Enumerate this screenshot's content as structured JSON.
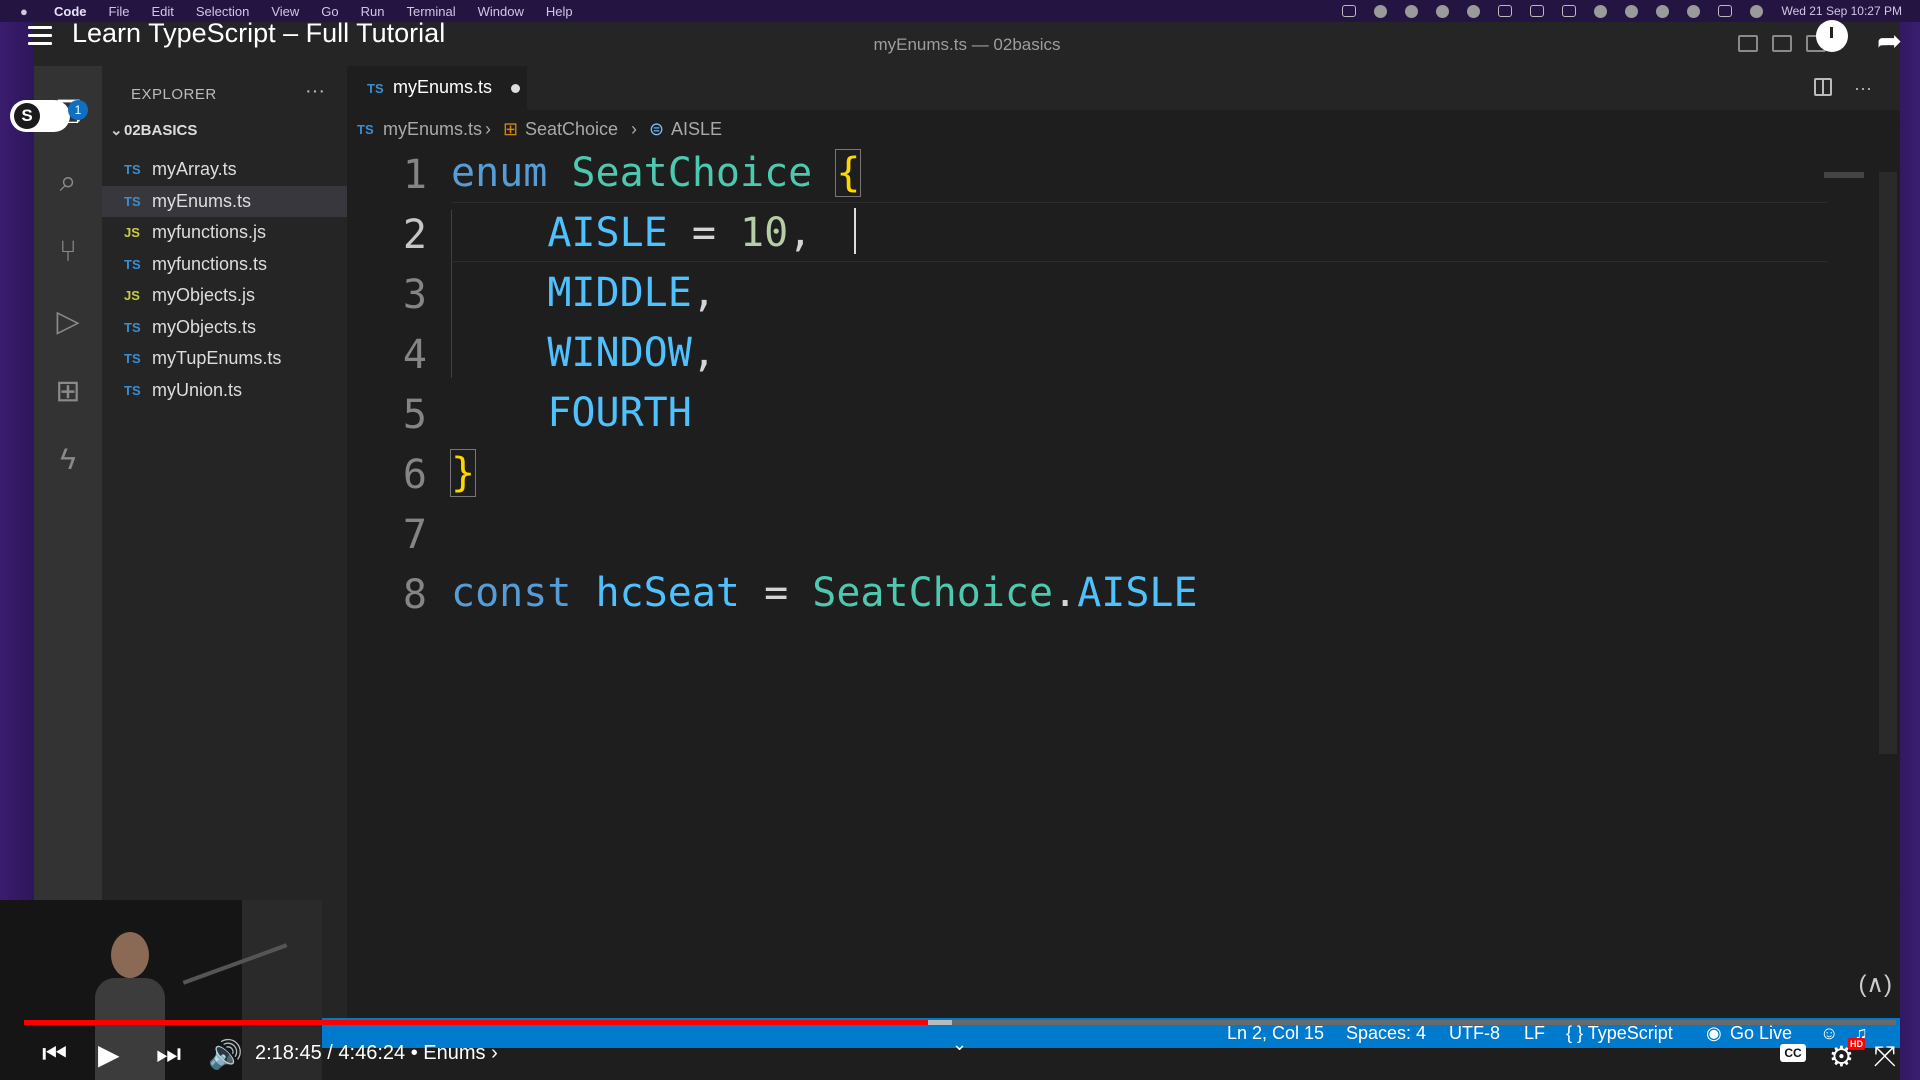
{
  "menubar": {
    "apple": "",
    "items": [
      "Code",
      "File",
      "Edit",
      "Selection",
      "View",
      "Go",
      "Run",
      "Terminal",
      "Window",
      "Help"
    ],
    "clock": "Wed 21 Sep  10:27 PM"
  },
  "video": {
    "title": "Learn TypeScript – Full Tutorial",
    "time": "2:18:45 / 4:46:24",
    "chapter": "• Enums ›",
    "progress_percent": 48.3,
    "hd_badge": "HD",
    "cc_label": "CC"
  },
  "window": {
    "title": "myEnums.ts — 02basics"
  },
  "activity": {
    "scm_badge_letter": "S",
    "notification_count": "1"
  },
  "explorer": {
    "header": "EXPLORER",
    "more": "···",
    "folder": "02BASICS",
    "files": [
      {
        "type": "TS",
        "name": "myArray.ts"
      },
      {
        "type": "TS",
        "name": "myEnums.ts"
      },
      {
        "type": "JS",
        "name": "myfunctions.js"
      },
      {
        "type": "TS",
        "name": "myfunctions.ts"
      },
      {
        "type": "JS",
        "name": "myObjects.js"
      },
      {
        "type": "TS",
        "name": "myObjects.ts"
      },
      {
        "type": "TS",
        "name": "myTupEnums.ts"
      },
      {
        "type": "TS",
        "name": "myUnion.ts"
      }
    ]
  },
  "tab": {
    "type": "TS",
    "name": "myEnums.ts"
  },
  "breadcrumb": {
    "file_type": "TS",
    "file": "myEnums.ts",
    "symbol1": "SeatChoice",
    "symbol2": "AISLE"
  },
  "code": {
    "line_numbers": [
      "1",
      "2",
      "3",
      "4",
      "5",
      "6",
      "7",
      "8"
    ],
    "l1": {
      "kw": "enum",
      "type": "SeatChoice",
      "brace": "{"
    },
    "l2": {
      "member": "AISLE",
      "op": " = ",
      "num": "10",
      "comma": ","
    },
    "l3": {
      "member": "MIDDLE",
      "comma": ","
    },
    "l4": {
      "member": "WINDOW",
      "comma": ","
    },
    "l5": {
      "member": "FOURTH"
    },
    "l6": {
      "brace": "}"
    },
    "l8": {
      "kw": "const",
      "var": "hcSeat",
      "op": " = ",
      "type": "SeatChoice",
      "dot": ".",
      "member": "AISLE"
    }
  },
  "status": {
    "position": "Ln 2, Col 15",
    "spaces": "Spaces: 4",
    "encoding": "UTF-8",
    "eol": "LF",
    "language": "{ } TypeScript",
    "golive": "Go Live"
  },
  "colors": {
    "status_bar": "#007acc",
    "keyword": "#569cd6",
    "type": "#4ec9b0",
    "member": "#4fc1ff",
    "number": "#b5cea8",
    "brace": "#ffd700",
    "progress_played": "#ff0000"
  }
}
